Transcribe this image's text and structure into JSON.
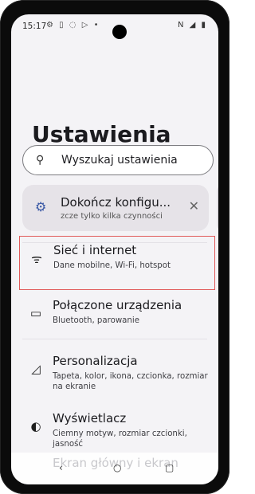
{
  "statusbar": {
    "time": "15:17",
    "left_icons": "⚙ ▯ ◌ ▷ •",
    "right_icons": "N ◢ ▮"
  },
  "page_title": "Ustawienia",
  "search": {
    "placeholder": "Wyszukaj ustawienia",
    "icon": "search-icon"
  },
  "suggestion_card": {
    "icon": "gear-icon",
    "title": "Dokończ konfigu...",
    "subtitle": "zcze tylko kilka czynności",
    "accent_color": "#3b5aa6"
  },
  "settings_list": [
    {
      "icon": "wifi-icon",
      "title": "Sieć i internet",
      "subtitle": "Dane mobilne, Wi-Fi, hotspot"
    },
    {
      "icon": "connected-devices-icon",
      "title": "Połączone urządzenia",
      "subtitle": "Bluetooth, parowanie"
    },
    {
      "icon": "personalization-icon",
      "title": "Personalizacja",
      "subtitle": "Tapeta, kolor, ikona, czcionka, rozmiar na ekranie"
    },
    {
      "icon": "display-icon",
      "title": "Wyświetlacz",
      "subtitle": "Ciemny motyw, rozmiar czcionki, jasność"
    }
  ],
  "partial_next_item": "Ekran główny i ekran",
  "navbar": {
    "back": "‹",
    "home": "○",
    "recent": "▢"
  },
  "colors": {
    "selection_outline": "#e15b5b"
  }
}
